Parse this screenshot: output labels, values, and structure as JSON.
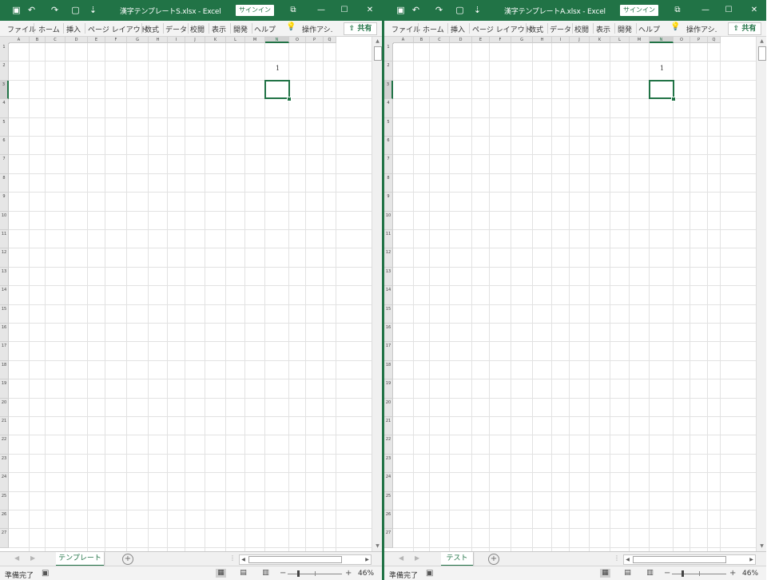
{
  "colors": {
    "accent": "#217346",
    "ribbon_bg": "#f3f3f3",
    "grid_line": "#e2e2e2",
    "header_bg": "#e6e6e6"
  },
  "columns": [
    "A",
    "B",
    "C",
    "D",
    "E",
    "F",
    "G",
    "H",
    "I",
    "J",
    "K",
    "L",
    "M",
    "N",
    "O",
    "P",
    "Q"
  ],
  "rows": [
    "1",
    "2",
    "3",
    "4",
    "5",
    "6",
    "7",
    "8",
    "9",
    "10",
    "11",
    "12",
    "13",
    "14",
    "15",
    "16",
    "17",
    "18",
    "19",
    "20",
    "21",
    "22",
    "23",
    "24",
    "25",
    "26",
    "27"
  ],
  "windows": [
    {
      "title": "漢字テンプレートS.xlsx  -  Excel",
      "signin": "サインイン",
      "tabs": [
        "ファイル",
        "ホーム",
        "挿入",
        "ページ レイアウト",
        "数式",
        "データ",
        "校閲",
        "表示",
        "開発",
        "ヘルプ"
      ],
      "tellme": "操作アシ.",
      "share": "共有",
      "cell_value": "1",
      "sheet_tab": "テンプレート",
      "status": "準備完了",
      "zoom": "46%",
      "icons": [
        "save-icon",
        "undo-icon",
        "redo-icon",
        "quick-access-icon",
        "customize-icon",
        "ribbon-display-icon",
        "minimize-icon",
        "maximize-icon",
        "close-icon",
        "lightbulb-icon",
        "share-icon",
        "add-sheet-icon",
        "macro-record-icon"
      ]
    },
    {
      "title": "漢字テンプレートA.xlsx  -  Excel",
      "signin": "サインイン",
      "tabs": [
        "ファイル",
        "ホーム",
        "挿入",
        "ページ レイアウト",
        "数式",
        "データ",
        "校閲",
        "表示",
        "開発",
        "ヘルプ"
      ],
      "tellme": "操作アシ.",
      "share": "共有",
      "cell_value": "1",
      "sheet_tab": "テスト",
      "status": "準備完了",
      "zoom": "46%",
      "icons": [
        "save-icon",
        "undo-icon",
        "redo-icon",
        "quick-access-icon",
        "customize-icon",
        "ribbon-display-icon",
        "minimize-icon",
        "maximize-icon",
        "close-icon",
        "lightbulb-icon",
        "share-icon",
        "add-sheet-icon",
        "macro-record-icon"
      ]
    }
  ]
}
